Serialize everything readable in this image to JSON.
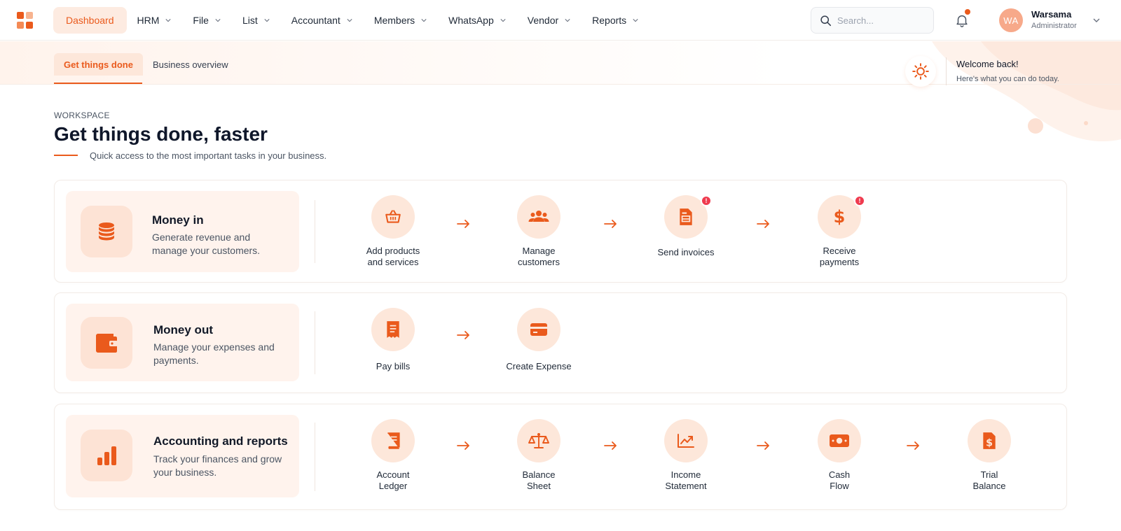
{
  "nav": {
    "items": [
      {
        "label": "Dashboard",
        "active": true,
        "dropdown": false
      },
      {
        "label": "HRM",
        "dropdown": true
      },
      {
        "label": "File",
        "dropdown": true
      },
      {
        "label": "List",
        "dropdown": true
      },
      {
        "label": "Accountant",
        "dropdown": true
      },
      {
        "label": "Members",
        "dropdown": true
      },
      {
        "label": "WhatsApp",
        "dropdown": true
      },
      {
        "label": "Vendor",
        "dropdown": true
      },
      {
        "label": "Reports",
        "dropdown": true
      }
    ],
    "search_placeholder": "Search...",
    "user": {
      "initials": "WA",
      "name": "Warsama",
      "role": "Administrator"
    }
  },
  "subheader": {
    "tabs": [
      {
        "label": "Get things done",
        "active": true
      },
      {
        "label": "Business overview",
        "active": false
      }
    ],
    "welcome_title": "Welcome back!",
    "welcome_sub": "Here's what you can do today."
  },
  "workspace": {
    "eyebrow": "WORKSPACE",
    "title": "Get things done, faster",
    "subtitle": "Quick access to the most important tasks in your business."
  },
  "sections": [
    {
      "title": "Money in",
      "desc": "Generate revenue and manage your customers.",
      "icon": "coins-icon",
      "steps": [
        {
          "label": "Add products and services",
          "icon": "basket-icon",
          "badge": ""
        },
        {
          "label": "Manage customers",
          "icon": "users-icon",
          "badge": ""
        },
        {
          "label": "Send invoices",
          "icon": "invoice-icon",
          "badge": "!"
        },
        {
          "label": "Receive payments",
          "icon": "dollar-icon",
          "badge": "!"
        }
      ]
    },
    {
      "title": "Money out",
      "desc": "Manage your expenses and payments.",
      "icon": "wallet-icon",
      "steps": [
        {
          "label": "Pay bills",
          "icon": "bill-icon",
          "badge": ""
        },
        {
          "label": "Create Expense",
          "icon": "card-icon",
          "badge": ""
        }
      ]
    },
    {
      "title": "Accounting and reports",
      "desc": "Track your finances and grow your business.",
      "icon": "bar-chart-icon",
      "steps": [
        {
          "label": "Account Ledger",
          "icon": "ledger-icon",
          "badge": ""
        },
        {
          "label": "Balance Sheet",
          "icon": "scale-icon",
          "badge": ""
        },
        {
          "label": "Income Statement",
          "icon": "trend-icon",
          "badge": ""
        },
        {
          "label": "Cash Flow",
          "icon": "cash-icon",
          "badge": ""
        },
        {
          "label": "Trial Balance",
          "icon": "dollar-doc-icon",
          "badge": ""
        }
      ]
    }
  ],
  "colors": {
    "accent": "#ea5a1c",
    "accent_soft": "#fde7da",
    "badge": "#ef3b4f"
  }
}
